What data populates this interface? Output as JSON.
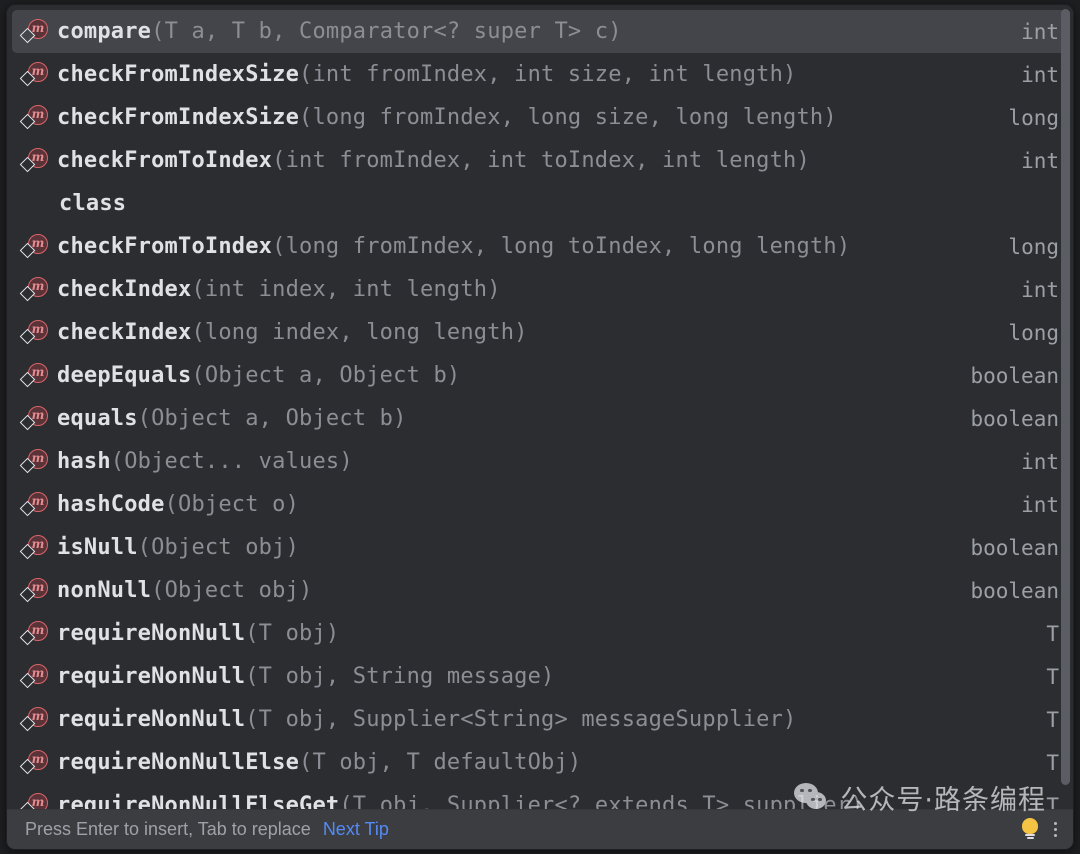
{
  "popup": {
    "kind": "code-completion-lookup",
    "background_color": "#2b2d30",
    "selected_color": "#43454a",
    "accent_color": "#548af7"
  },
  "items": [
    {
      "icon": "static-method-icon",
      "name": "compare",
      "signature": "(T a, T b, Comparator<? super T> c)",
      "type": "int",
      "selected": true
    },
    {
      "icon": "static-method-icon",
      "name": "checkFromIndexSize",
      "signature": "(int fromIndex, int size, int length)",
      "type": "int",
      "selected": false
    },
    {
      "icon": "static-method-icon",
      "name": "checkFromIndexSize",
      "signature": "(long fromIndex, long size, long length)",
      "type": "long",
      "selected": false
    },
    {
      "icon": "static-method-icon",
      "name": "checkFromToIndex",
      "signature": "(int fromIndex, int toIndex, int length)",
      "type": "int",
      "selected": false
    },
    {
      "icon": "none",
      "name": "class",
      "signature": "",
      "type": "",
      "selected": false
    },
    {
      "icon": "static-method-icon",
      "name": "checkFromToIndex",
      "signature": "(long fromIndex, long toIndex, long length)",
      "type": "long",
      "selected": false
    },
    {
      "icon": "static-method-icon",
      "name": "checkIndex",
      "signature": "(int index, int length)",
      "type": "int",
      "selected": false
    },
    {
      "icon": "static-method-icon",
      "name": "checkIndex",
      "signature": "(long index, long length)",
      "type": "long",
      "selected": false
    },
    {
      "icon": "static-method-icon",
      "name": "deepEquals",
      "signature": "(Object a, Object b)",
      "type": "boolean",
      "selected": false
    },
    {
      "icon": "static-method-icon",
      "name": "equals",
      "signature": "(Object a, Object b)",
      "type": "boolean",
      "selected": false
    },
    {
      "icon": "static-method-icon",
      "name": "hash",
      "signature": "(Object... values)",
      "type": "int",
      "selected": false
    },
    {
      "icon": "static-method-icon",
      "name": "hashCode",
      "signature": "(Object o)",
      "type": "int",
      "selected": false
    },
    {
      "icon": "static-method-icon",
      "name": "isNull",
      "signature": "(Object obj)",
      "type": "boolean",
      "selected": false
    },
    {
      "icon": "static-method-icon",
      "name": "nonNull",
      "signature": "(Object obj)",
      "type": "boolean",
      "selected": false
    },
    {
      "icon": "static-method-icon",
      "name": "requireNonNull",
      "signature": "(T obj)",
      "type": "T",
      "selected": false
    },
    {
      "icon": "static-method-icon",
      "name": "requireNonNull",
      "signature": "(T obj, String message)",
      "type": "T",
      "selected": false
    },
    {
      "icon": "static-method-icon",
      "name": "requireNonNull",
      "signature": "(T obj, Supplier<String> messageSupplier)",
      "type": "T",
      "selected": false
    },
    {
      "icon": "static-method-icon",
      "name": "requireNonNullElse",
      "signature": "(T obj, T defaultObj)",
      "type": "T",
      "selected": false
    },
    {
      "icon": "static-method-icon",
      "name": "requireNonNullElseGet",
      "signature": "(T obj, Supplier<? extends T> supplier)",
      "type": "T",
      "selected": false
    }
  ],
  "hint_bar": {
    "text": "Press Enter to insert, Tab to replace",
    "next_tip_label": "Next Tip",
    "bulb_icon": "lightbulb-icon",
    "menu_icon": "vertical-dots-icon"
  },
  "watermark": {
    "logo_icon": "wechat-logo-icon",
    "text": "公众号·路条编程"
  },
  "scrollbar": {
    "orientation": "vertical"
  }
}
